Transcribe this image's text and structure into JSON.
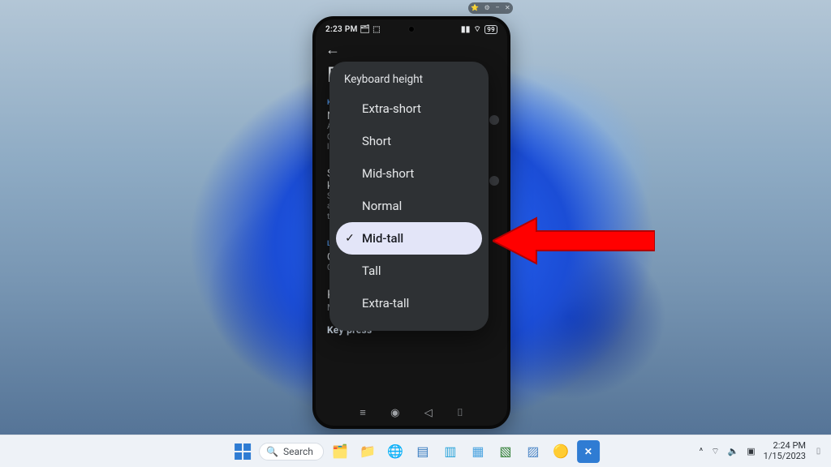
{
  "desktop": {
    "taskbar": {
      "search_placeholder": "Search",
      "tray": {
        "chevron": "^",
        "wifi": "⌔",
        "volume": "🔈",
        "battery": "▣"
      },
      "clock": {
        "time": "2:24 PM",
        "date": "1/15/2023"
      }
    }
  },
  "scrcpy_controls": {
    "pin": "⭐",
    "gear": "⚙",
    "min": "–",
    "close": "✕"
  },
  "phone": {
    "status": {
      "time": "2:23 PM",
      "icons_left": "🗂 ⬚",
      "signal": "▮▮",
      "wifi": "⌔",
      "battery": "99"
    },
    "back_glyph": "←",
    "page_title_initial": "P",
    "sections": [
      {
        "label": "K",
        "item": {
          "title": "N",
          "sub": "A\nC\nla"
        }
      },
      {
        "label": "",
        "item": {
          "title": "S\nk",
          "sub": "S\na\nth"
        }
      },
      {
        "label": "L",
        "item": {
          "title": "C",
          "sub": "C"
        }
      }
    ],
    "setting": {
      "name": "Keyboard height",
      "value": "Mid-tall"
    },
    "last_row": "Key press",
    "nav": {
      "recent": "≡",
      "home": "◉",
      "back": "◁",
      "extra": "⌷"
    }
  },
  "dialog": {
    "title": "Keyboard height",
    "options": [
      {
        "label": "Extra-short",
        "selected": false
      },
      {
        "label": "Short",
        "selected": false
      },
      {
        "label": "Mid-short",
        "selected": false
      },
      {
        "label": "Normal",
        "selected": false
      },
      {
        "label": "Mid-tall",
        "selected": true
      },
      {
        "label": "Tall",
        "selected": false
      },
      {
        "label": "Extra-tall",
        "selected": false
      }
    ]
  },
  "annotation": {
    "arrow_color": "#ff0000",
    "points_to": "Mid-tall"
  }
}
